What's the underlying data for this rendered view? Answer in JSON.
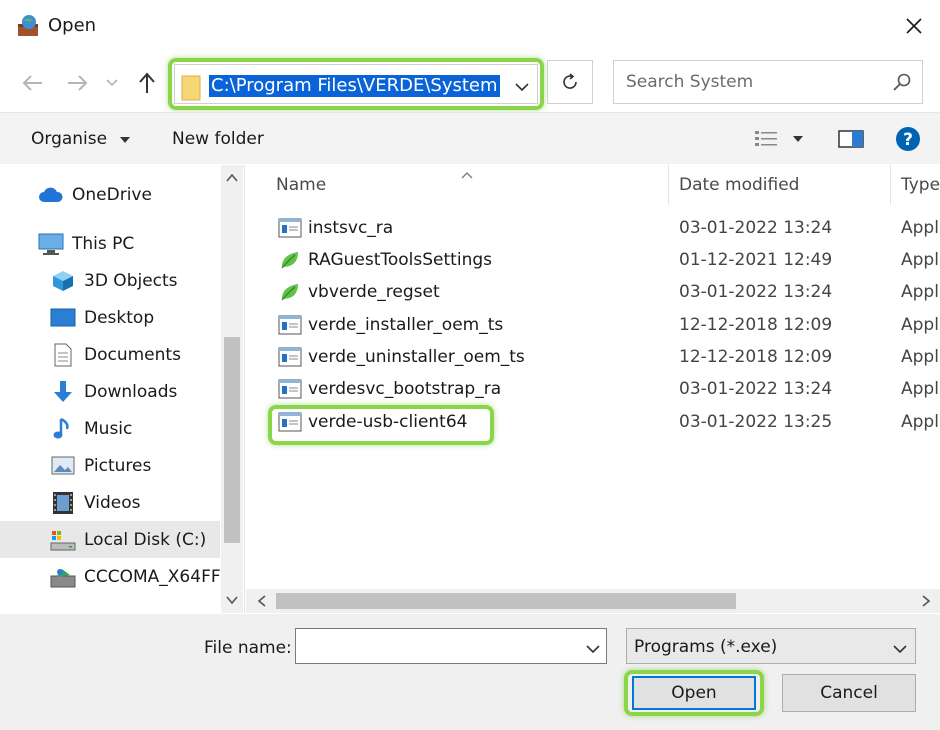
{
  "window": {
    "title": "Open"
  },
  "address": {
    "path": "C:\\Program Files\\VERDE\\System"
  },
  "search": {
    "placeholder": "Search System"
  },
  "toolbar": {
    "organise_label": "Organise",
    "new_folder_label": "New folder"
  },
  "sidebar": {
    "items": [
      {
        "label": "OneDrive",
        "icon": "cloud-icon"
      },
      {
        "label": "This PC",
        "icon": "computer-icon"
      },
      {
        "label": "3D Objects",
        "icon": "cube-icon"
      },
      {
        "label": "Desktop",
        "icon": "desktop-icon"
      },
      {
        "label": "Documents",
        "icon": "document-icon"
      },
      {
        "label": "Downloads",
        "icon": "download-icon"
      },
      {
        "label": "Music",
        "icon": "music-icon"
      },
      {
        "label": "Pictures",
        "icon": "picture-icon"
      },
      {
        "label": "Videos",
        "icon": "video-icon"
      },
      {
        "label": "Local Disk (C:)",
        "icon": "disk-icon",
        "selected": true
      },
      {
        "label": "CCCOMA_X64FF",
        "icon": "dvd-icon"
      }
    ]
  },
  "columns": {
    "name": "Name",
    "date": "Date modified",
    "type": "Type"
  },
  "files": [
    {
      "name": "instsvc_ra",
      "date": "03-01-2022 13:24",
      "type": "Appl",
      "icon": "exe-window-icon"
    },
    {
      "name": "RAGuestToolsSettings",
      "date": "01-12-2021 12:49",
      "type": "Appl",
      "icon": "leaf-icon"
    },
    {
      "name": "vbverde_regset",
      "date": "03-01-2022 13:24",
      "type": "Appl",
      "icon": "leaf-icon"
    },
    {
      "name": "verde_installer_oem_ts",
      "date": "12-12-2018 12:09",
      "type": "Appl",
      "icon": "exe-window-icon"
    },
    {
      "name": "verde_uninstaller_oem_ts",
      "date": "12-12-2018 12:09",
      "type": "Appl",
      "icon": "exe-window-icon"
    },
    {
      "name": "verdesvc_bootstrap_ra",
      "date": "03-01-2022 13:24",
      "type": "Appl",
      "icon": "exe-window-icon"
    },
    {
      "name": "verde-usb-client64",
      "date": "03-01-2022 13:25",
      "type": "Appl",
      "icon": "exe-window-icon"
    }
  ],
  "bottom": {
    "file_name_label": "File name:",
    "file_name_value": "",
    "file_type_value": "Programs (*.exe)",
    "open_label": "Open",
    "cancel_label": "Cancel"
  },
  "colors": {
    "highlight": "#8ad54a",
    "selection": "#0a64d8",
    "help": "#0063b1"
  }
}
